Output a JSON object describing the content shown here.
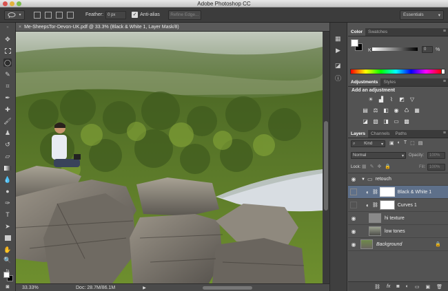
{
  "app": {
    "title": "Adobe Photoshop CC"
  },
  "options": {
    "feather_label": "Feather:",
    "feather_value": "0 px",
    "antialias_label": "Anti-alias",
    "refine_label": "Refine Edge...",
    "workspace": "Essentials"
  },
  "document": {
    "tab_title": "Me-SheepsTor-Devon-UK.pdf @ 33.3% (Black & White 1, Layer Mask/8)"
  },
  "status": {
    "zoom": "33.33%",
    "doc": "Doc: 28.7M/86.1M"
  },
  "color_panel": {
    "tabs": [
      "Color",
      "Swatches"
    ],
    "channel": "K",
    "value": "0",
    "unit": "%",
    "foreground": "#ffffff",
    "background": "#000000"
  },
  "adjustments_panel": {
    "tabs": [
      "Adjustments",
      "Styles"
    ],
    "heading": "Add an adjustment"
  },
  "layers_panel": {
    "tabs": [
      "Layers",
      "Channels",
      "Paths"
    ],
    "filter": "Kind",
    "blend_mode": "Normal",
    "opacity_label": "Opacity:",
    "opacity_value": "100%",
    "lock_label": "Lock:",
    "fill_label": "Fill:",
    "fill_value": "100%",
    "layers": [
      {
        "name": "retouch",
        "type": "group"
      },
      {
        "name": "Black & White 1",
        "type": "adjustment",
        "selected": true
      },
      {
        "name": "Curves 1",
        "type": "adjustment"
      },
      {
        "name": "hi texture",
        "type": "pixel"
      },
      {
        "name": "low tones",
        "type": "pixel"
      },
      {
        "name": "Background",
        "type": "background",
        "locked": true
      }
    ]
  }
}
